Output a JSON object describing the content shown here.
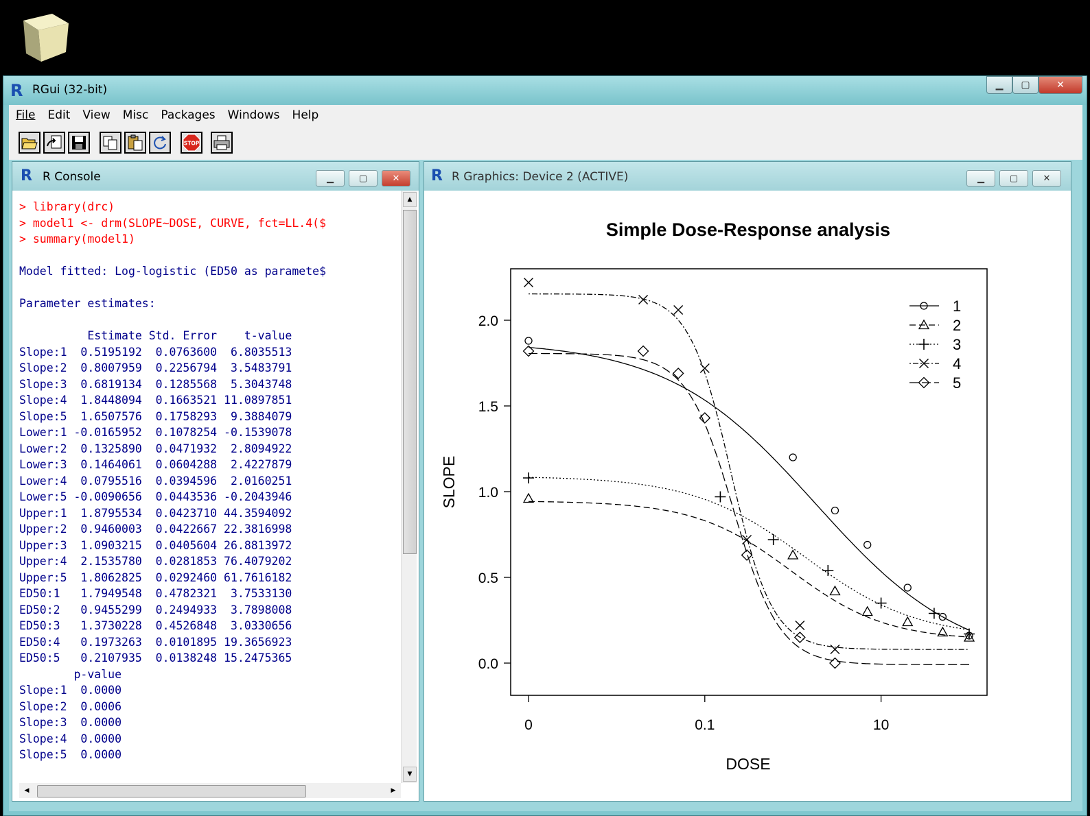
{
  "app": {
    "title": "RGui (32-bit)",
    "menu": [
      "File",
      "Edit",
      "View",
      "Misc",
      "Packages",
      "Windows",
      "Help"
    ],
    "toolbar_icons": [
      "open-script-icon",
      "load-workspace-icon",
      "save-workspace-icon",
      "copy-icon",
      "paste-icon",
      "refresh-icon",
      "stop-icon",
      "print-icon"
    ],
    "stop_label": "STOP"
  },
  "console": {
    "title": "R Console",
    "lines": [
      {
        "text": "> library(drc)",
        "kind": "cmd"
      },
      {
        "text": "> model1 <- drm(SLOPE~DOSE, CURVE, fct=LL.4($",
        "kind": "cmd"
      },
      {
        "text": "> summary(model1)",
        "kind": "cmd"
      },
      {
        "text": "",
        "kind": "out"
      },
      {
        "text": "Model fitted: Log-logistic (ED50 as paramete$",
        "kind": "out"
      },
      {
        "text": "",
        "kind": "out"
      },
      {
        "text": "Parameter estimates:",
        "kind": "out"
      },
      {
        "text": "",
        "kind": "out"
      },
      {
        "text": "          Estimate Std. Error    t-value",
        "kind": "out"
      },
      {
        "text": "Slope:1  0.5195192  0.0763600  6.8035513",
        "kind": "out"
      },
      {
        "text": "Slope:2  0.8007959  0.2256794  3.5483791",
        "kind": "out"
      },
      {
        "text": "Slope:3  0.6819134  0.1285568  5.3043748",
        "kind": "out"
      },
      {
        "text": "Slope:4  1.8448094  0.1663521 11.0897851",
        "kind": "out"
      },
      {
        "text": "Slope:5  1.6507576  0.1758293  9.3884079",
        "kind": "out"
      },
      {
        "text": "Lower:1 -0.0165952  0.1078254 -0.1539078",
        "kind": "out"
      },
      {
        "text": "Lower:2  0.1325890  0.0471932  2.8094922",
        "kind": "out"
      },
      {
        "text": "Lower:3  0.1464061  0.0604288  2.4227879",
        "kind": "out"
      },
      {
        "text": "Lower:4  0.0795516  0.0394596  2.0160251",
        "kind": "out"
      },
      {
        "text": "Lower:5 -0.0090656  0.0443536 -0.2043946",
        "kind": "out"
      },
      {
        "text": "Upper:1  1.8795534  0.0423710 44.3594092",
        "kind": "out"
      },
      {
        "text": "Upper:2  0.9460003  0.0422667 22.3816998",
        "kind": "out"
      },
      {
        "text": "Upper:3  1.0903215  0.0405604 26.8813972",
        "kind": "out"
      },
      {
        "text": "Upper:4  2.1535780  0.0281853 76.4079202",
        "kind": "out"
      },
      {
        "text": "Upper:5  1.8062825  0.0292460 61.7616182",
        "kind": "out"
      },
      {
        "text": "ED50:1   1.7949548  0.4782321  3.7533130",
        "kind": "out"
      },
      {
        "text": "ED50:2   0.9455299  0.2494933  3.7898008",
        "kind": "out"
      },
      {
        "text": "ED50:3   1.3730228  0.4526848  3.0330656",
        "kind": "out"
      },
      {
        "text": "ED50:4   0.1973263  0.0101895 19.3656923",
        "kind": "out"
      },
      {
        "text": "ED50:5   0.2107935  0.0138248 15.2475365",
        "kind": "out"
      },
      {
        "text": "        p-value",
        "kind": "out"
      },
      {
        "text": "Slope:1  0.0000",
        "kind": "out"
      },
      {
        "text": "Slope:2  0.0006",
        "kind": "out"
      },
      {
        "text": "Slope:3  0.0000",
        "kind": "out"
      },
      {
        "text": "Slope:4  0.0000",
        "kind": "out"
      },
      {
        "text": "Slope:5  0.0000",
        "kind": "out"
      }
    ]
  },
  "graphics": {
    "title": "R Graphics: Device 2 (ACTIVE)"
  },
  "chart_data": {
    "type": "scatter",
    "title": "Simple Dose-Response analysis",
    "xlabel": "DOSE",
    "ylabel": "SLOPE",
    "x_scale": "log",
    "xlim": [
      0.001,
      100
    ],
    "ylim": [
      -0.1,
      2.3
    ],
    "xticks": [
      {
        "value": 0.001,
        "label": "0"
      },
      {
        "value": 0.1,
        "label": "0.1"
      },
      {
        "value": 10,
        "label": "10"
      }
    ],
    "yticks": [
      0.0,
      0.5,
      1.0,
      1.5,
      2.0
    ],
    "legend_position": "top-right",
    "series": [
      {
        "name": "1",
        "marker": "circle",
        "dash": "solid",
        "points": [
          [
            0.001,
            1.88
          ],
          [
            1,
            1.2
          ],
          [
            3,
            0.89
          ],
          [
            7,
            0.69
          ],
          [
            20,
            0.44
          ],
          [
            50,
            0.27
          ],
          [
            100,
            0.16
          ]
        ],
        "fit": {
          "slope": 0.5195192,
          "lower": -0.0165952,
          "upper": 1.8795534,
          "ed50": 1.7949548
        }
      },
      {
        "name": "2",
        "marker": "triangle",
        "dash": "dashed",
        "points": [
          [
            0.001,
            0.96
          ],
          [
            1,
            0.63
          ],
          [
            3,
            0.42
          ],
          [
            7,
            0.3
          ],
          [
            20,
            0.24
          ],
          [
            50,
            0.18
          ],
          [
            100,
            0.15
          ]
        ],
        "fit": {
          "slope": 0.8007959,
          "lower": 0.132589,
          "upper": 0.9460003,
          "ed50": 0.9455299
        }
      },
      {
        "name": "3",
        "marker": "plus",
        "dash": "dotted",
        "points": [
          [
            0.001,
            1.08
          ],
          [
            0.15,
            0.97
          ],
          [
            0.6,
            0.72
          ],
          [
            2.5,
            0.54
          ],
          [
            10,
            0.35
          ],
          [
            40,
            0.29
          ],
          [
            100,
            0.17
          ]
        ],
        "fit": {
          "slope": 0.6819134,
          "lower": 0.1464061,
          "upper": 1.0903215,
          "ed50": 1.3730228
        }
      },
      {
        "name": "4",
        "marker": "cross",
        "dash": "dotdash",
        "points": [
          [
            0.001,
            2.22
          ],
          [
            0.02,
            2.12
          ],
          [
            0.05,
            2.06
          ],
          [
            0.1,
            1.72
          ],
          [
            0.3,
            0.72
          ],
          [
            1.2,
            0.22
          ],
          [
            3,
            0.08
          ]
        ],
        "fit": {
          "slope": 1.8448094,
          "lower": 0.0795516,
          "upper": 2.153578,
          "ed50": 0.1973263
        }
      },
      {
        "name": "5",
        "marker": "diamond",
        "dash": "longdash",
        "points": [
          [
            0.001,
            1.82
          ],
          [
            0.02,
            1.82
          ],
          [
            0.05,
            1.69
          ],
          [
            0.1,
            1.43
          ],
          [
            0.3,
            0.63
          ],
          [
            1.2,
            0.15
          ],
          [
            3,
            0.0
          ]
        ],
        "fit": {
          "slope": 1.6507576,
          "lower": -0.0090656,
          "upper": 1.8062825,
          "ed50": 0.2107935
        }
      }
    ]
  },
  "colors": {
    "console_cmd": "#ff0000",
    "console_out": "#00008b",
    "title_bar": "#7fc7cf",
    "close_button": "#c43f2e"
  }
}
